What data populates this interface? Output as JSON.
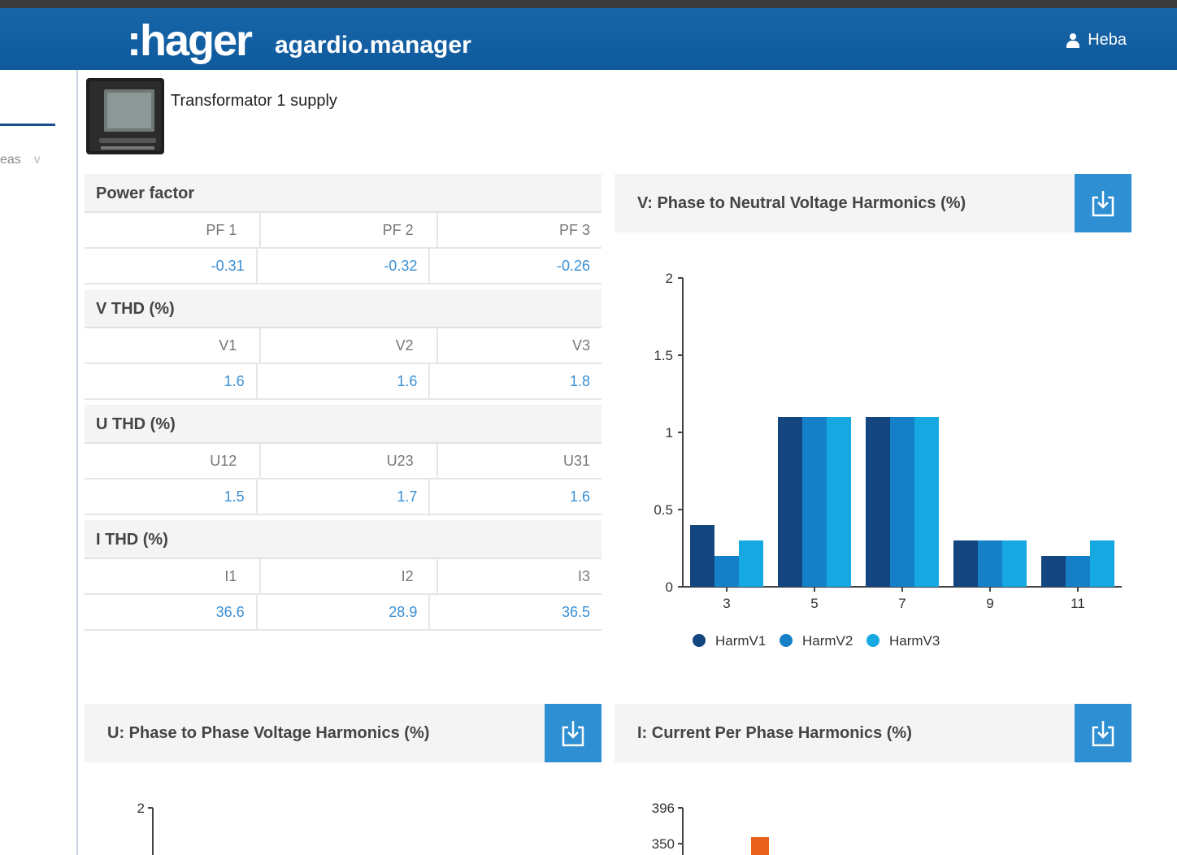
{
  "header": {
    "logo": ":hager",
    "app_name": "agardio.manager",
    "user": "Heba"
  },
  "sidebar": {
    "select_text": "eas",
    "chevron": "v"
  },
  "device": {
    "title": "Transformator 1 supply",
    "image_icon": "power-meter-device"
  },
  "sections": [
    {
      "title": "Power factor",
      "labels": [
        "PF 1",
        "PF 2",
        "PF 3"
      ],
      "values": [
        "-0.31",
        "-0.32",
        "-0.26"
      ]
    },
    {
      "title": "V THD (%)",
      "labels": [
        "V1",
        "V2",
        "V3"
      ],
      "values": [
        "1.6",
        "1.6",
        "1.8"
      ]
    },
    {
      "title": "U THD (%)",
      "labels": [
        "U12",
        "U23",
        "U31"
      ],
      "values": [
        "1.5",
        "1.7",
        "1.6"
      ]
    },
    {
      "title": "I THD (%)",
      "labels": [
        "I1",
        "I2",
        "I3"
      ],
      "values": [
        "36.6",
        "28.9",
        "36.5"
      ]
    }
  ],
  "panels": {
    "v": {
      "title": "V: Phase to Neutral Voltage Harmonics (%)"
    },
    "u": {
      "title": "U: Phase to Phase Voltage Harmonics (%)"
    },
    "i": {
      "title": "I: Current Per Phase Harmonics (%)"
    }
  },
  "colors": {
    "topbar": "#1765a8",
    "harmV1": "#13457f",
    "harmV2": "#1580c8",
    "harmV3": "#16a8e0",
    "accent_value": "#3a8fd4",
    "current_bar": "#e8621c"
  },
  "chart_data": [
    {
      "type": "bar",
      "title": "V: Phase to Neutral Voltage Harmonics (%)",
      "categories": [
        "3",
        "5",
        "7",
        "9",
        "11"
      ],
      "series": [
        {
          "name": "HarmV1",
          "values": [
            0.4,
            1.1,
            1.1,
            0.3,
            0.2
          ]
        },
        {
          "name": "HarmV2",
          "values": [
            0.2,
            1.1,
            1.1,
            0.3,
            0.2
          ]
        },
        {
          "name": "HarmV3",
          "values": [
            0.3,
            1.1,
            1.1,
            0.3,
            0.3
          ]
        }
      ],
      "yticks": [
        "0",
        "0.5",
        "1",
        "1.5",
        "2"
      ],
      "ylim": [
        0,
        2
      ],
      "legend": "bottom"
    },
    {
      "type": "bar",
      "title": "U: Phase to Phase Voltage Harmonics (%)",
      "yticks": [
        "2"
      ],
      "ylim": [
        0,
        2
      ]
    },
    {
      "type": "bar",
      "title": "I: Current Per Phase Harmonics (%)",
      "yticks": [
        "350",
        "396"
      ],
      "partial_values": [
        350
      ]
    }
  ]
}
